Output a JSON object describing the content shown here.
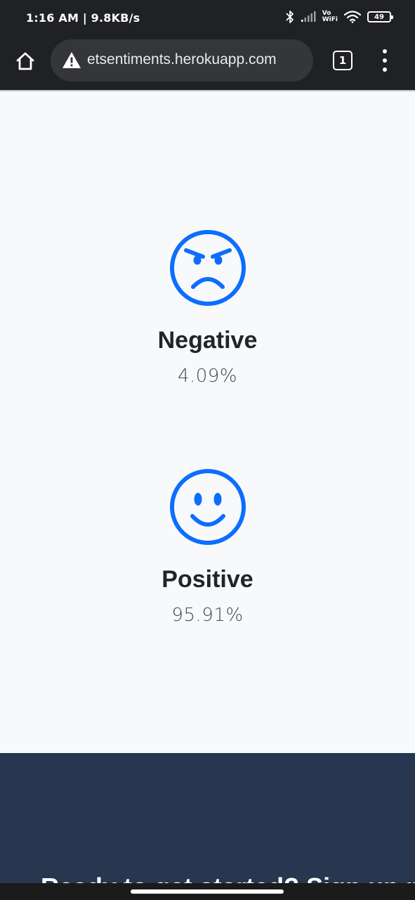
{
  "status_bar": {
    "time": "1:16 AM",
    "network_speed": "9.8KB/s",
    "volte_line1": "Vo",
    "volte_line2": "WiFi",
    "battery": "49"
  },
  "browser": {
    "url": "etsentiments.herokuapp.com",
    "tab_count": "1",
    "icons": {
      "home": "home-icon",
      "security": "warning-icon",
      "tabs": "tab-switcher-icon",
      "menu": "more-vert-icon"
    }
  },
  "results": [
    {
      "label": "Negative",
      "value": "4.09%",
      "icon": "angry-face-icon"
    },
    {
      "label": "Positive",
      "value": "95.91%",
      "icon": "smiling-face-icon"
    }
  ],
  "footer": {
    "heading": "Ready to get started? Sign up now."
  },
  "colors": {
    "accent": "#0d6efd",
    "chrome_bg": "#202124",
    "url_bar_bg": "#35363a",
    "page_bg": "#f8f9fa",
    "footer_bg": "#28374f",
    "label_text": "#212529"
  }
}
